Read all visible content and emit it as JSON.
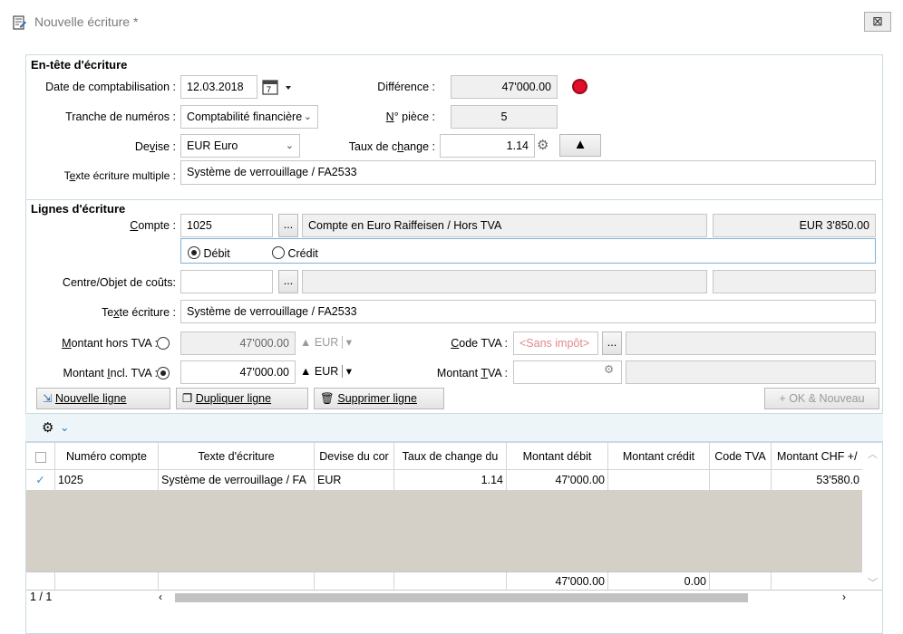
{
  "window": {
    "title": "Nouvelle écriture *",
    "close_label": "⊠"
  },
  "header": {
    "section_title": "En-tête d'écriture",
    "date_label": "Date de comptabilisation :",
    "date_value": "12.03.2018",
    "difference_label": "Différence :",
    "difference_value": "47'000.00",
    "tranche_label": "Tranche de numéros :",
    "tranche_value": "Comptabilité financière",
    "piece_label": "N° pièce :",
    "piece_value": "5",
    "devise_label": "Devise :",
    "devise_value": "EUR Euro",
    "taux_label": "Taux de change :",
    "taux_value": "1.14",
    "texte_multiple_label": "Texte écriture multiple :",
    "texte_multiple_value": "Système de verrouillage / FA2533"
  },
  "lines": {
    "section_title": "Lignes d'écriture",
    "compte_label": "Compte :",
    "compte_value": "1025",
    "compte_desc": "Compte en Euro Raiffeisen / Hors TVA",
    "compte_balance": "EUR 3'850.00",
    "debit_label": "Débit",
    "credit_label": "Crédit",
    "centre_label": "Centre/Objet de coûts:",
    "texte_label": "Texte écriture :",
    "texte_value": "Système de verrouillage / FA2533",
    "montant_hors_label": "Montant hors TVA :",
    "montant_hors_value": "47'000.00",
    "montant_hors_cur": "EUR",
    "code_tva_label": "Code TVA :",
    "code_tva_value": "<Sans impôt>",
    "montant_incl_label": "Montant Incl. TVA :",
    "montant_incl_value": "47'000.00",
    "montant_incl_cur": "EUR",
    "montant_tva_label": "Montant TVA :",
    "dots": "...",
    "selected_radio": "debit",
    "selected_amount": "incl"
  },
  "toolbar": {
    "nouvelle": "Nouvelle ligne",
    "dupliquer": "Dupliquer ligne",
    "supprimer": "Supprimer ligne",
    "ok": "+ OK & Nouveau"
  },
  "table": {
    "columns": [
      "Numéro compte",
      "Texte d'écriture",
      "Devise du cor",
      "Taux de change du",
      "Montant débit",
      "Montant crédit",
      "Code TVA",
      "Montant CHF +/"
    ],
    "rows": [
      {
        "check": "✓",
        "cells": [
          "1025",
          "Système de verrouillage / FA",
          "EUR",
          "1.14",
          "47'000.00",
          "",
          "",
          "53'580.0"
        ]
      }
    ],
    "totals": [
      "",
      "",
      "",
      "",
      "47'000.00",
      "0.00",
      "",
      ""
    ],
    "pager": "1 / 1"
  }
}
